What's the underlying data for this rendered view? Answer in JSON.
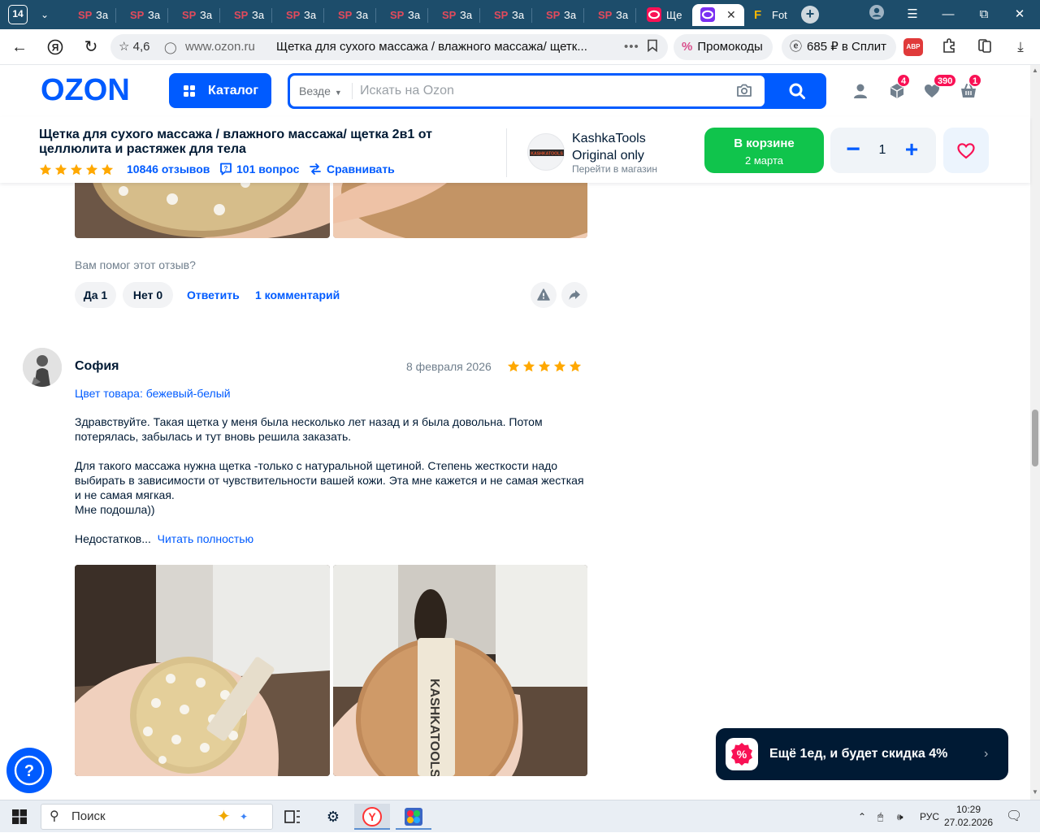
{
  "browser": {
    "tab_count": "14",
    "tabs": [
      {
        "icon": "SP",
        "label": "За"
      },
      {
        "icon": "SP",
        "label": "За"
      },
      {
        "icon": "SP",
        "label": "За"
      },
      {
        "icon": "SP",
        "label": "За"
      },
      {
        "icon": "SP",
        "label": "За"
      },
      {
        "icon": "SP",
        "label": "За"
      },
      {
        "icon": "SP",
        "label": "За"
      },
      {
        "icon": "SP",
        "label": "За"
      },
      {
        "icon": "SP",
        "label": "За"
      },
      {
        "icon": "SP",
        "label": "За"
      },
      {
        "icon": "SP",
        "label": "За"
      },
      {
        "icon": "ozon-icon",
        "label": "Ще"
      },
      {
        "icon": "ozon-icon",
        "label": ""
      },
      {
        "icon": "F",
        "label": "Fot"
      }
    ],
    "site_rating": "4,6",
    "domain": "www.ozon.ru",
    "page_title": "Щетка для сухого массажа / влажного массажа/ щетк...",
    "promo_pill": "Промокоды",
    "split_pill": "685 ₽ в Сплит",
    "abp_label": "ABP"
  },
  "ozon": {
    "logo": "OZON",
    "catalog_label": "Каталог",
    "search_scope": "Везде",
    "search_placeholder": "Искать на Ozon",
    "orders_badge": "4",
    "favorites_badge": "390",
    "cart_badge": "1"
  },
  "product": {
    "title": "Щетка для сухого массажа / влажного массажа/ щетка 2в1 от целлюлита и растяжек для тела",
    "rating_stars": 5,
    "reviews": "10846 отзывов",
    "questions": "101 вопрос",
    "compare": "Сравнивать",
    "seller_name": "KashkaTools Original only",
    "seller_link": "Перейти в магазин",
    "seller_logo_text": "KASHKATOOLS",
    "in_cart": "В корзине",
    "delivery": "2 марта",
    "quantity": "1",
    "qty_minus": "−",
    "qty_plus": "+"
  },
  "prev_review": {
    "helped_question": "Вам помог этот отзыв?",
    "yes": "Да 1",
    "no": "Нет 0",
    "reply": "Ответить",
    "comments": "1 комментарий"
  },
  "review": {
    "author": "София",
    "date": "8 февраля 2026",
    "stars": 5,
    "color": "Цвет товара: бежевый-белый",
    "paragraph1": "Здравствуйте. Такая щетка у меня была несколько лет назад и я была довольна. Потом потерялась, забылась и тут вновь решила заказать.",
    "paragraph2": "Для такого массажа нужна щетка -только с натуральной щетиной. Степень жесткости надо выбирать в зависимости от чувствительности вашей кожи. Эта мне кажется и не самая жесткая и не самая мягкая.",
    "paragraph3": "Мне подошла))",
    "cons": "Недостатков...",
    "read_more": "Читать полностью",
    "photo_brand_text": "KASHKATOOLS"
  },
  "promo_toast": {
    "text": "Ещё 1ед, и будет скидка 4%"
  },
  "taskbar": {
    "search_label": "Поиск",
    "language": "РУС",
    "time": "10:29",
    "date": "27.02.2026"
  },
  "colors": {
    "ozon_blue": "#005bff",
    "cart_green": "#10c44c",
    "star_orange": "#ffa800",
    "badge_pink": "#f91155",
    "tabstrip": "#1d4d6b"
  }
}
